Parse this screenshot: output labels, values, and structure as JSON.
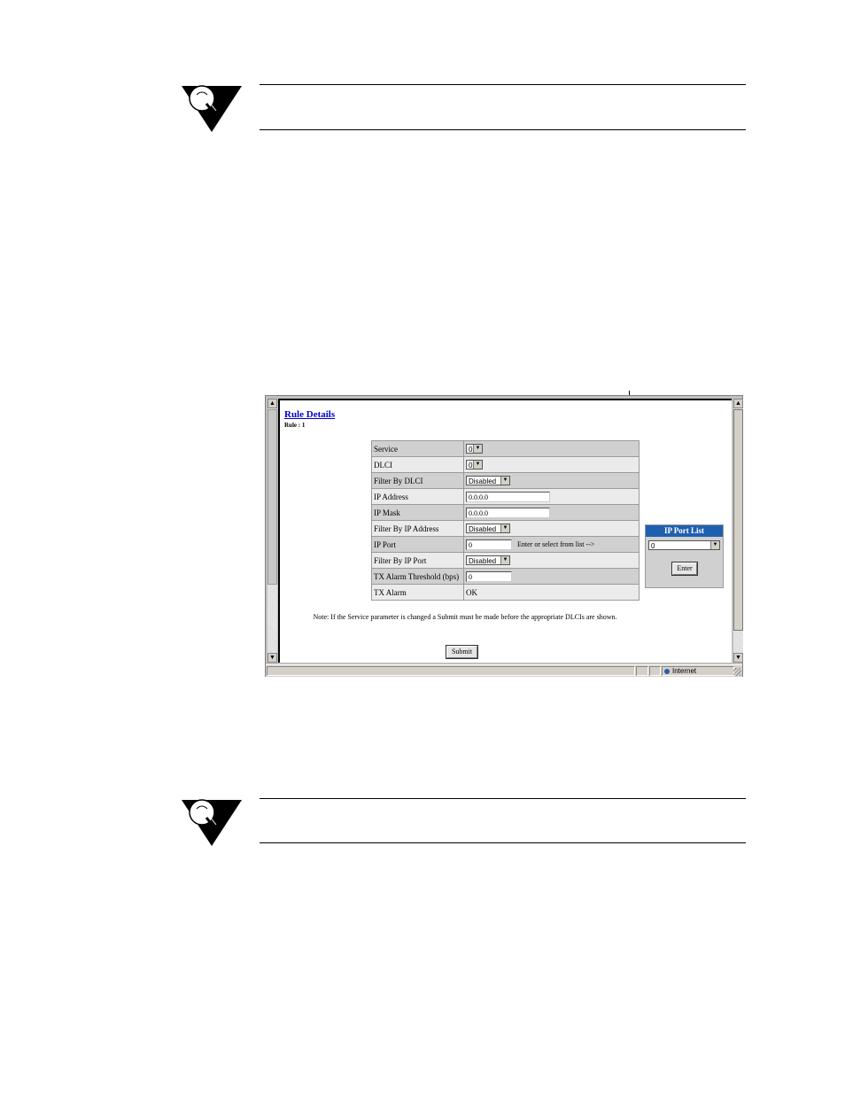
{
  "rule_details": {
    "title": "Rule Details",
    "subtitle": "Rule : 1",
    "rows": [
      {
        "label": "Service",
        "control": "select",
        "value": "0"
      },
      {
        "label": "DLCI",
        "control": "select",
        "value": "0"
      },
      {
        "label": "Filter By DLCI",
        "control": "select",
        "value": "Disabled"
      },
      {
        "label": "IP Address",
        "control": "text",
        "value": "0.0.0.0"
      },
      {
        "label": "IP Mask",
        "control": "text",
        "value": "0.0.0.0"
      },
      {
        "label": "Filter By IP Address",
        "control": "select",
        "value": "Disabled"
      },
      {
        "label": "IP Port",
        "control": "text",
        "value": "0",
        "hint": "Enter or select from list -->"
      },
      {
        "label": "Filter By IP Port",
        "control": "select",
        "value": "Disabled"
      },
      {
        "label": "TX Alarm Threshold (bps)",
        "control": "text",
        "value": "0"
      },
      {
        "label": "TX Alarm",
        "control": "static",
        "value": "OK"
      }
    ],
    "note": "Note:  If the Service parameter is changed a Submit must be made before the appropriate DLCIs are shown.",
    "submit_label": "Submit"
  },
  "ip_port_list": {
    "title": "IP Port List",
    "selected": "0",
    "enter_label": "Enter"
  },
  "statusbar": {
    "zone": "Internet"
  }
}
